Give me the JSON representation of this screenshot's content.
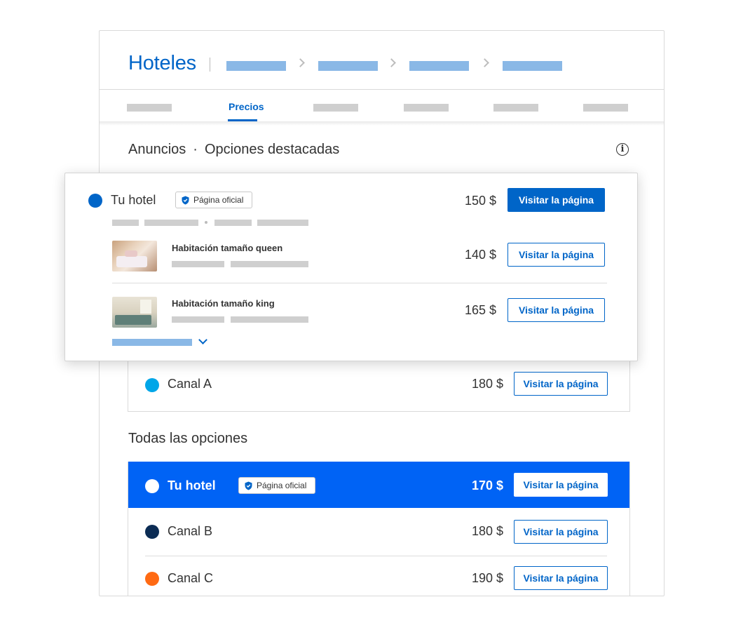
{
  "header": {
    "title": "Hoteles"
  },
  "tabs": {
    "active_label": "Precios"
  },
  "sections": {
    "ads_title": "Anuncios",
    "ads_subtitle": "Opciones destacadas",
    "all_options_title": "Todas las opciones"
  },
  "featured": {
    "name": "Tu hotel",
    "badge": "Página oficial",
    "price": "150 $",
    "button": "Visitar la página",
    "rooms": [
      {
        "name": "Habitación tamaño queen",
        "price": "140 $",
        "button": "Visitar la página"
      },
      {
        "name": "Habitación tamaño king",
        "price": "165 $",
        "button": "Visitar la página"
      }
    ]
  },
  "ad_channel": {
    "name": "Canal A",
    "price": "180 $",
    "button": "Visitar la página",
    "color": "#00a6e8"
  },
  "all_options": [
    {
      "name": "Tu hotel",
      "badge": "Página oficial",
      "price": "170 $",
      "button": "Visitar la página",
      "color": "#ffffff"
    },
    {
      "name": "Canal B",
      "price": "180 $",
      "button": "Visitar la página",
      "color": "#0b2c54"
    },
    {
      "name": "Canal C",
      "price": "190 $",
      "button": "Visitar la página",
      "color": "#ff6a13"
    }
  ],
  "colors": {
    "brand": "#0065c8",
    "highlight": "#0063f5",
    "placeholder": "#cfcfcf",
    "crumb": "#8ab8e6"
  },
  "icons": [
    "info-icon",
    "shield-icon",
    "chevron-right-icon",
    "chevron-down-icon"
  ]
}
